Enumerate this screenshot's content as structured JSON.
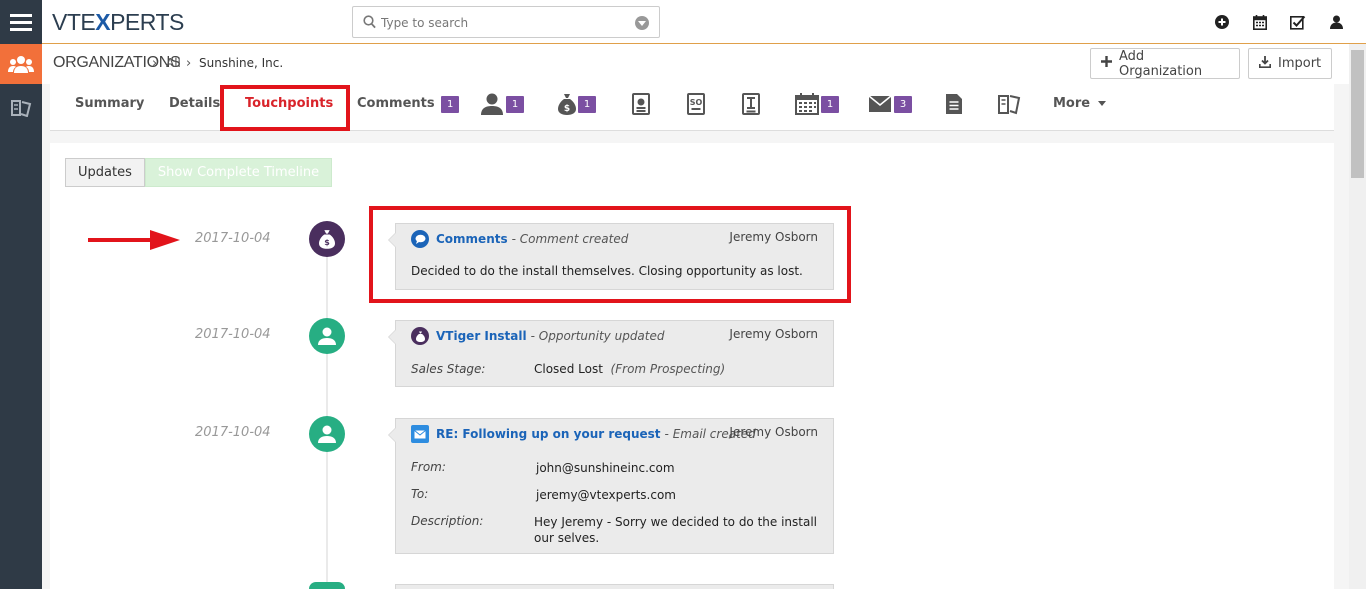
{
  "app": {
    "logo_prefix": "VTE",
    "logo_x": "X",
    "logo_suffix": "PERTS"
  },
  "search": {
    "placeholder": "Type to search"
  },
  "top_icons": [
    "plus-circle-icon",
    "calendar-icon",
    "checkbox-icon",
    "user-icon"
  ],
  "breadcrumb": {
    "module": "ORGANIZATIONS",
    "filter": "All",
    "record": "Sunshine, Inc."
  },
  "header_buttons": {
    "add": "Add Organization",
    "import": "Import"
  },
  "tabs": {
    "summary": "Summary",
    "details": "Details",
    "touchpoints": "Touchpoints",
    "comments": "Comments",
    "comments_count": "1",
    "contacts_count": "1",
    "opportunities_count": "1",
    "calendar_count": "1",
    "emails_count": "3",
    "more": "More"
  },
  "timeline_toggle": {
    "updates": "Updates",
    "complete": "Show Complete Timeline"
  },
  "timeline": [
    {
      "date": "2017-10-04",
      "title": "Comments",
      "action": "- Comment created",
      "user": "Jeremy Osborn",
      "body": "Decided to do the install themselves. Closing opportunity as lost."
    },
    {
      "date": "2017-10-04",
      "title": "VTiger Install",
      "action": "- Opportunity updated",
      "user": "Jeremy Osborn",
      "field_label": "Sales Stage:",
      "field_value": "Closed Lost",
      "field_prev": "(From Prospecting)"
    },
    {
      "date": "2017-10-04",
      "title": "RE: Following up on your request",
      "action": "- Email created",
      "user": "Jeremy Osborn",
      "from_label": "From:",
      "from_value": "john@sunshineinc.com",
      "to_label": "To:",
      "to_value": "jeremy@vtexperts.com",
      "desc_label": "Description:",
      "desc_value_1": "Hey Jeremy - Sorry we decided to do the install",
      "desc_value_2": "our selves."
    }
  ],
  "colors": {
    "accent": "#f2703a",
    "highlight": "#e2141b",
    "link": "#1b64b8",
    "badge": "#7b4fa2",
    "green": "#27ae83",
    "purple": "#4a2e5e"
  }
}
